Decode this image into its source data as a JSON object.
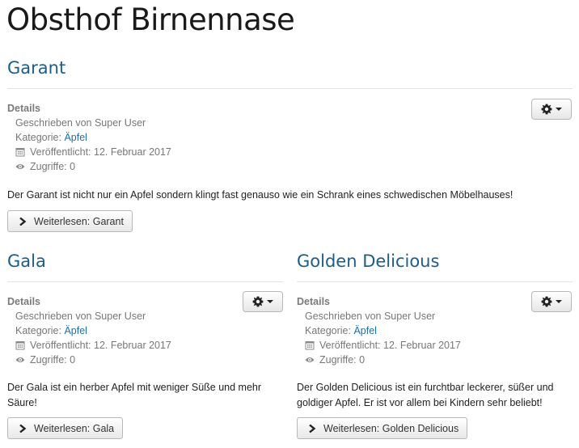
{
  "page": {
    "title": "Obsthof Birnennase"
  },
  "articles": [
    {
      "title": "Garant",
      "details_label": "Details",
      "author": "Geschrieben von Super User",
      "category_label": "Kategorie:",
      "category": "Äpfel",
      "published": "Veröffentlicht: 12. Februar 2017",
      "hits": "Zugriffe: 0",
      "intro": "Der Garant ist nicht nur ein Apfel sondern klingt fast genauso wie ein Schrank eines schwedischen Möbelhauses!",
      "readmore": "Weiterlesen: Garant"
    },
    {
      "title": "Gala",
      "details_label": "Details",
      "author": "Geschrieben von Super User",
      "category_label": "Kategorie:",
      "category": "Äpfel",
      "published": "Veröffentlicht: 12. Februar 2017",
      "hits": "Zugriffe: 0",
      "intro": "Der Gala ist ein herber Apfel mit weniger Süße und mehr Säure!",
      "readmore": "Weiterlesen: Gala"
    },
    {
      "title": "Golden Delicious",
      "details_label": "Details",
      "author": "Geschrieben von Super User",
      "category_label": "Kategorie:",
      "category": "Äpfel",
      "published": "Veröffentlicht: 12. Februar 2017",
      "hits": "Zugriffe: 0",
      "intro": "Der Golden Delicious ist ein furchtbar leckerer, süßer und goldiger Apfel. Er ist vor allem bei Kindern sehr beliebt!",
      "readmore": "Weiterlesen: Golden Delicious"
    }
  ],
  "icons": {
    "gear": "gear-icon",
    "caret": "caret-down-icon",
    "calendar": "calendar-icon",
    "eye": "eye-icon",
    "readmore": "chevron-right-icon"
  },
  "colors": {
    "title_link": "#1d5d8a",
    "category_link": "#1c6eb0"
  }
}
